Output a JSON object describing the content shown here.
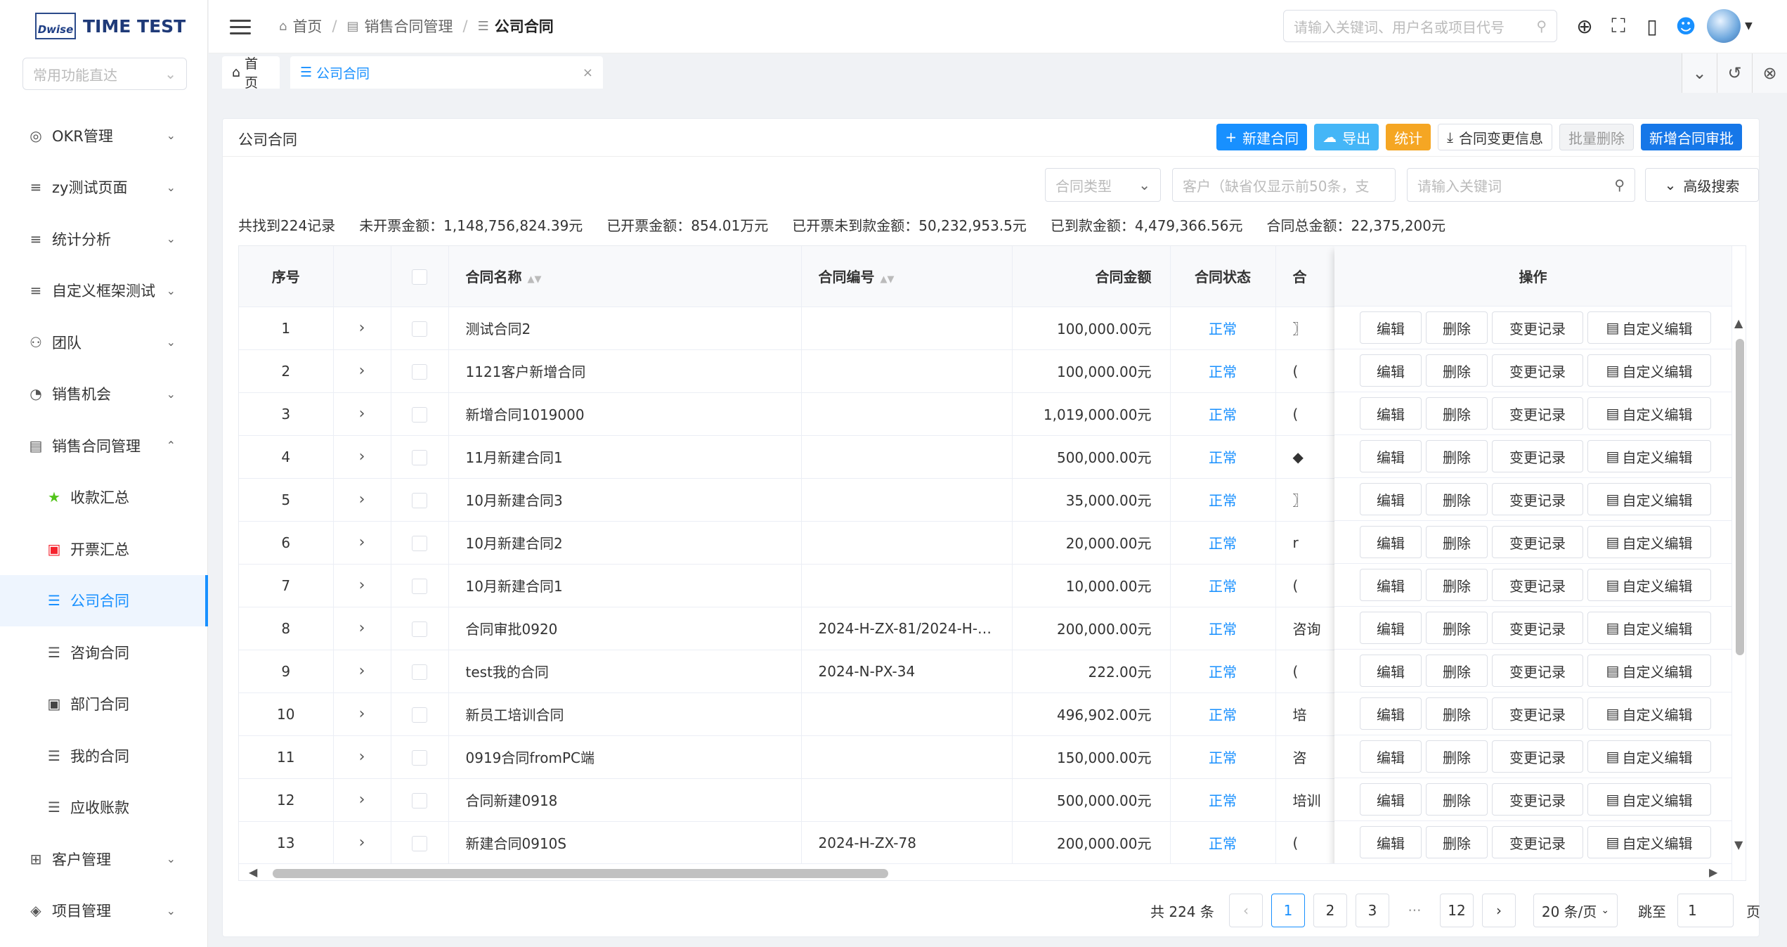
{
  "app": {
    "logo_mark": "Dwise",
    "logo_title": "TIME TEST",
    "quick_placeholder": "常用功能直达"
  },
  "sidebar": {
    "items": [
      {
        "label": "OKR管理",
        "icon": "okr-icon",
        "glyph": "◎",
        "arrow": "⌄"
      },
      {
        "label": "zy测试页面",
        "icon": "list-icon",
        "glyph": "≡",
        "arrow": "⌄"
      },
      {
        "label": "统计分析",
        "icon": "list-icon",
        "glyph": "≡",
        "arrow": "⌄"
      },
      {
        "label": "自定义框架测试",
        "icon": "list-icon",
        "glyph": "≡",
        "arrow": "⌄"
      },
      {
        "label": "团队",
        "icon": "team-icon",
        "glyph": "⚇",
        "arrow": "⌄"
      },
      {
        "label": "销售机会",
        "icon": "pie-icon",
        "glyph": "◔",
        "arrow": "⌄"
      },
      {
        "label": "销售合同管理",
        "icon": "contract-icon",
        "glyph": "▤",
        "arrow": "⌃"
      },
      {
        "label": "收款汇总",
        "icon": "star-icon",
        "glyph": "★",
        "sub": true
      },
      {
        "label": "开票汇总",
        "icon": "invoice-icon",
        "glyph": "▣",
        "sub": true
      },
      {
        "label": "公司合同",
        "icon": "filter-icon",
        "glyph": "☰",
        "sub": true,
        "active": true
      },
      {
        "label": "咨询合同",
        "icon": "filter-icon",
        "glyph": "☰",
        "sub": true
      },
      {
        "label": "部门合同",
        "icon": "dept-icon",
        "glyph": "▣",
        "sub": true
      },
      {
        "label": "我的合同",
        "icon": "filter-icon",
        "glyph": "☰",
        "sub": true
      },
      {
        "label": "应收账款",
        "icon": "filter-icon",
        "glyph": "☰",
        "sub": true
      },
      {
        "label": "客户管理",
        "icon": "customer-icon",
        "glyph": "⊞",
        "arrow": "⌄"
      },
      {
        "label": "项目管理",
        "icon": "layers-icon",
        "glyph": "◈",
        "arrow": "⌄"
      }
    ]
  },
  "header": {
    "breadcrumb": [
      "首页",
      "销售合同管理",
      "公司合同"
    ],
    "search_placeholder": "请输入关键词、用户名或项目代号"
  },
  "tabs": [
    {
      "label": "首页"
    },
    {
      "label": "公司合同"
    }
  ],
  "panel": {
    "title": "公司合同",
    "buttons": {
      "new": "新建合同",
      "export": "导出",
      "stats": "统计",
      "change_info": "合同变更信息",
      "batch_delete": "批量删除",
      "new_approval": "新增合同审批"
    },
    "filters": {
      "type_placeholder": "合同类型",
      "customer_placeholder": "客户（缺省仅显示前50条，支",
      "keyword_placeholder": "请输入关键词",
      "advanced": "高级搜索"
    },
    "summary": [
      "共找到224记录",
      "未开票金额：1,148,756,824.39元",
      "已开票金额：854.01万元",
      "已开票未到款金额：50,232,953.5元",
      "已到款金额：4,479,366.56元",
      "合同总金额：22,375,200元"
    ]
  },
  "table": {
    "headers": {
      "index": "序号",
      "name": "合同名称",
      "code": "合同编号",
      "amount": "合同金额",
      "status": "合同状态",
      "type": "合",
      "ops": "操作"
    },
    "op_labels": {
      "edit": "编辑",
      "delete": "删除",
      "history": "变更记录",
      "custom": "自定义编辑"
    },
    "rows": [
      {
        "idx": "1",
        "name": "测试合同2",
        "code": "",
        "amount": "100,000.00元",
        "status": "正常",
        "type": "〗"
      },
      {
        "idx": "2",
        "name": "1121客户新增合同",
        "code": "",
        "amount": "100,000.00元",
        "status": "正常",
        "type": "("
      },
      {
        "idx": "3",
        "name": "新增合同1019000",
        "code": "",
        "amount": "1,019,000.00元",
        "status": "正常",
        "type": "("
      },
      {
        "idx": "4",
        "name": "11月新建合同1",
        "code": "",
        "amount": "500,000.00元",
        "status": "正常",
        "type": "◆"
      },
      {
        "idx": "5",
        "name": "10月新建合同3",
        "code": "",
        "amount": "35,000.00元",
        "status": "正常",
        "type": "〗"
      },
      {
        "idx": "6",
        "name": "10月新建合同2",
        "code": "",
        "amount": "20,000.00元",
        "status": "正常",
        "type": "r"
      },
      {
        "idx": "7",
        "name": "10月新建合同1",
        "code": "",
        "amount": "10,000.00元",
        "status": "正常",
        "type": "("
      },
      {
        "idx": "8",
        "name": "合同审批0920",
        "code": "2024-H-ZX-81/2024-H-…",
        "amount": "200,000.00元",
        "status": "正常",
        "type": "咨询"
      },
      {
        "idx": "9",
        "name": "test我的合同",
        "code": "2024-N-PX-34",
        "amount": "222.00元",
        "status": "正常",
        "type": "("
      },
      {
        "idx": "10",
        "name": "新员工培训合同",
        "code": "",
        "amount": "496,902.00元",
        "status": "正常",
        "type": "培"
      },
      {
        "idx": "11",
        "name": "0919合同fromPC端",
        "code": "",
        "amount": "150,000.00元",
        "status": "正常",
        "type": "咨"
      },
      {
        "idx": "12",
        "name": "合同新建0918",
        "code": "",
        "amount": "500,000.00元",
        "status": "正常",
        "type": "培训"
      },
      {
        "idx": "13",
        "name": "新建合同0910S",
        "code": "2024-H-ZX-78",
        "amount": "200,000.00元",
        "status": "正常",
        "type": "("
      }
    ]
  },
  "pagination": {
    "total": "共 224 条",
    "pages": [
      "1",
      "2",
      "3",
      "···",
      "12"
    ],
    "active": "1",
    "page_size": "20 条/页",
    "jump_label": "跳至",
    "jump_value": "1",
    "page_unit": "页"
  },
  "colors": {
    "accent": "#1890ff",
    "orange": "#f5a623",
    "cyan": "#45b6f7"
  }
}
